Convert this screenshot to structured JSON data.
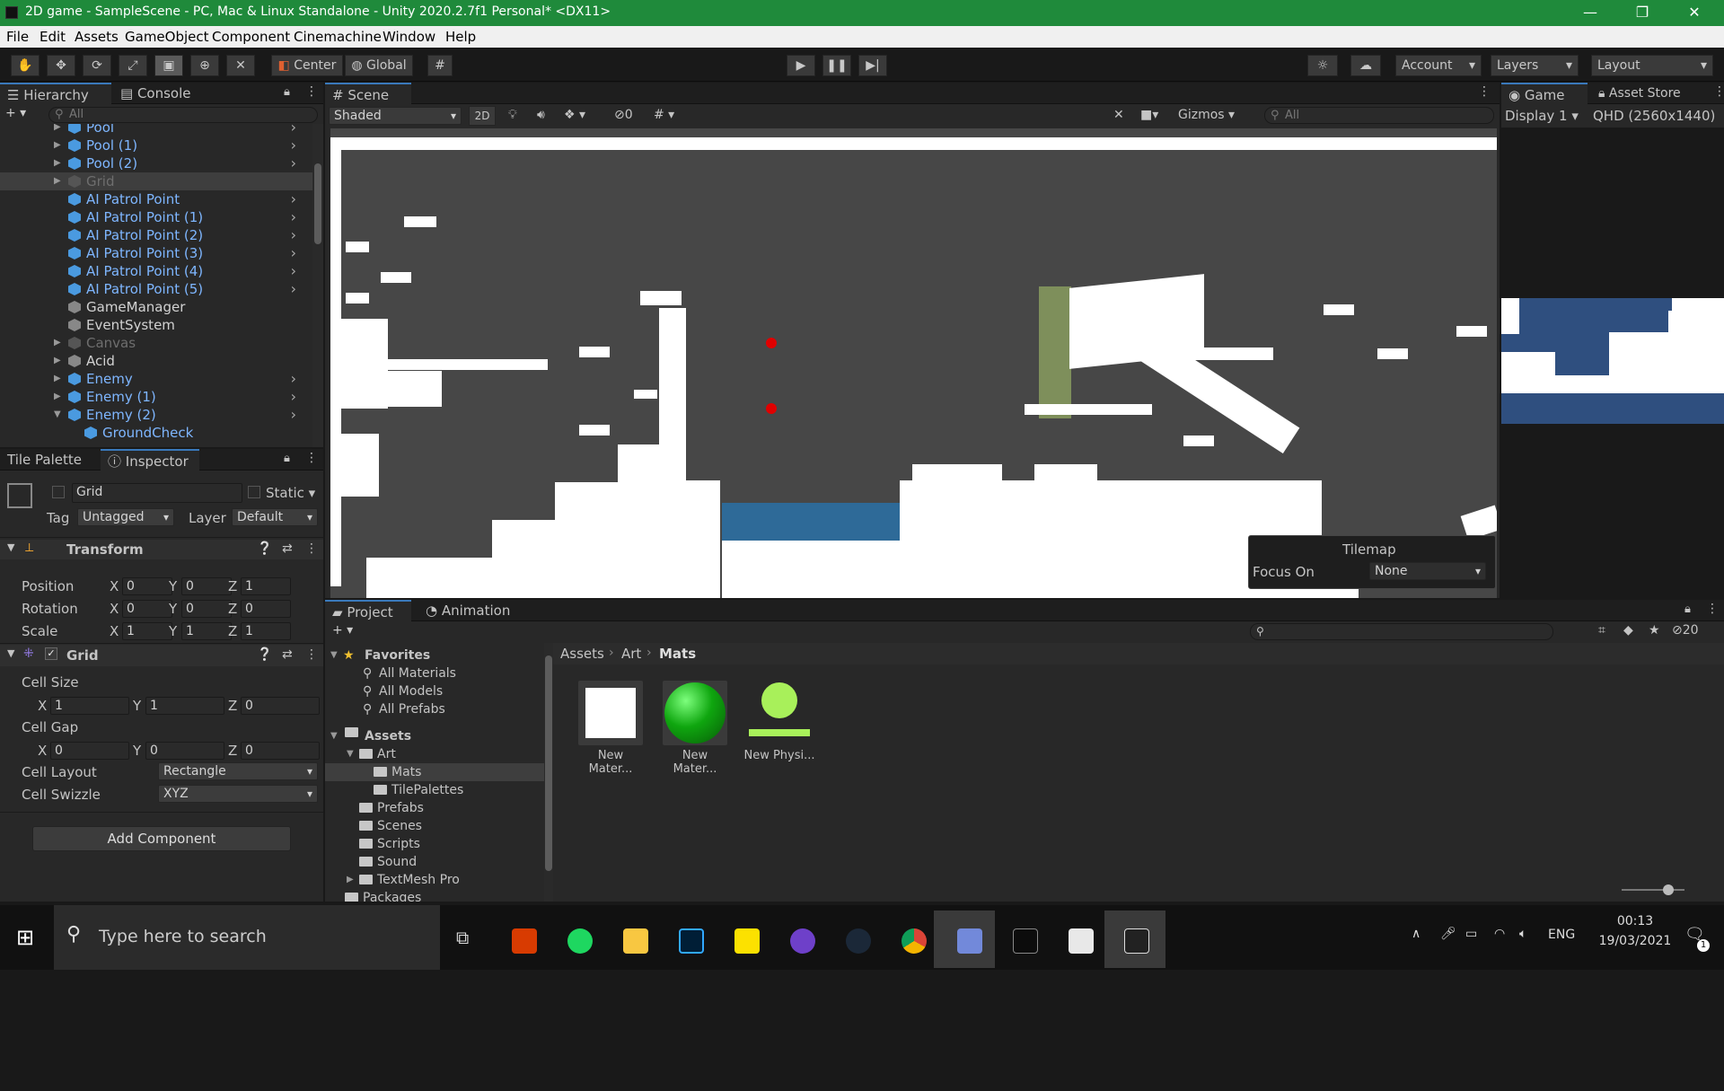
{
  "window": {
    "title": "2D game - SampleScene - PC, Mac & Linux Standalone - Unity 2020.2.7f1 Personal* <DX11>"
  },
  "menu": [
    "File",
    "Edit",
    "Assets",
    "GameObject",
    "Component",
    "Cinemachine",
    "Window",
    "Help"
  ],
  "toolbar": {
    "pivot": "Center",
    "space": "Global",
    "account": "Account",
    "layers": "Layers",
    "layout": "Layout"
  },
  "hierarchy": {
    "tab": "Hierarchy",
    "console_tab": "Console",
    "search_placeholder": "All",
    "items": [
      {
        "label": "Pool",
        "style": "blue",
        "indent": 1
      },
      {
        "label": "Pool (1)",
        "style": "blue",
        "indent": 1
      },
      {
        "label": "Pool (2)",
        "style": "blue",
        "indent": 1
      },
      {
        "label": "Grid",
        "style": "grey",
        "indent": 1
      },
      {
        "label": "AI Patrol Point",
        "style": "blue",
        "indent": 1
      },
      {
        "label": "AI Patrol Point (1)",
        "style": "blue",
        "indent": 1
      },
      {
        "label": "AI Patrol Point (2)",
        "style": "blue",
        "indent": 1
      },
      {
        "label": "AI Patrol Point (3)",
        "style": "blue",
        "indent": 1
      },
      {
        "label": "AI Patrol Point (4)",
        "style": "blue",
        "indent": 1
      },
      {
        "label": "AI Patrol Point (5)",
        "style": "blue",
        "indent": 1
      },
      {
        "label": "GameManager",
        "style": "white",
        "indent": 1
      },
      {
        "label": "EventSystem",
        "style": "white",
        "indent": 1
      },
      {
        "label": "Canvas",
        "style": "grey",
        "indent": 1
      },
      {
        "label": "Acid",
        "style": "white",
        "indent": 1
      },
      {
        "label": "Enemy",
        "style": "blue",
        "indent": 1
      },
      {
        "label": "Enemy (1)",
        "style": "blue",
        "indent": 1
      },
      {
        "label": "Enemy (2)",
        "style": "blue",
        "indent": 1
      },
      {
        "label": "GroundCheck",
        "style": "blue",
        "indent": 2
      }
    ]
  },
  "inspector": {
    "tile_palette_tab": "Tile Palette",
    "inspector_tab": "Inspector",
    "object_name": "Grid",
    "static_label": "Static",
    "tag_label": "Tag",
    "tag_value": "Untagged",
    "layer_label": "Layer",
    "layer_value": "Default",
    "transform": {
      "title": "Transform",
      "position_label": "Position",
      "rotation_label": "Rotation",
      "scale_label": "Scale",
      "position": [
        "0",
        "0",
        "1"
      ],
      "rotation": [
        "0",
        "0",
        "0"
      ],
      "scale": [
        "1",
        "1",
        "1"
      ]
    },
    "grid": {
      "title": "Grid",
      "cell_size_label": "Cell Size",
      "cell_size": [
        "1",
        "1",
        "0"
      ],
      "cell_gap_label": "Cell Gap",
      "cell_gap": [
        "0",
        "0",
        "0"
      ],
      "cell_layout_label": "Cell Layout",
      "cell_layout": "Rectangle",
      "cell_swizzle_label": "Cell Swizzle",
      "cell_swizzle": "XYZ"
    },
    "add_component": "Add Component"
  },
  "scene": {
    "tab": "Scene",
    "shading": "Shaded",
    "mode_2d": "2D",
    "hidden_count": "0",
    "gizmos": "Gizmos",
    "search_placeholder": "All",
    "tilemap_overlay": {
      "title": "Tilemap",
      "focus_label": "Focus On",
      "focus_value": "None"
    }
  },
  "game": {
    "tab": "Game",
    "asset_store_tab": "Asset Store",
    "display": "Display 1",
    "resolution": "QHD (2560x1440)"
  },
  "project": {
    "tab": "Project",
    "animation_tab": "Animation",
    "breadcrumb": [
      "Assets",
      "Art",
      "Mats"
    ],
    "hidden_count": "20",
    "favorites_label": "Favorites",
    "favorites": [
      "All Materials",
      "All Models",
      "All Prefabs"
    ],
    "assets_label": "Assets",
    "tree": [
      {
        "label": "Art",
        "indent": 1,
        "open": true
      },
      {
        "label": "Mats",
        "indent": 2,
        "selected": true
      },
      {
        "label": "TilePalettes",
        "indent": 2
      },
      {
        "label": "Prefabs",
        "indent": 1
      },
      {
        "label": "Scenes",
        "indent": 1
      },
      {
        "label": "Scripts",
        "indent": 1
      },
      {
        "label": "Sound",
        "indent": 1
      },
      {
        "label": "TextMesh Pro",
        "indent": 1,
        "collapsed": true
      },
      {
        "label": "Packages",
        "indent": 0
      }
    ],
    "assets": [
      {
        "label": "New Mater...",
        "type": "white-material"
      },
      {
        "label": "New Mater...",
        "type": "green-material"
      },
      {
        "label": "New Physi...",
        "type": "physics-material"
      }
    ]
  },
  "taskbar": {
    "search_placeholder": "Type here to search",
    "language": "ENG",
    "time": "00:13",
    "date": "19/03/2021",
    "notifications": "1"
  },
  "colors": {
    "titlebar": "#1f8a3b",
    "accent": "#3a79bb",
    "scene_bg": "#474747",
    "water": "#2e6a98",
    "green_block": "#7e8f5b"
  }
}
